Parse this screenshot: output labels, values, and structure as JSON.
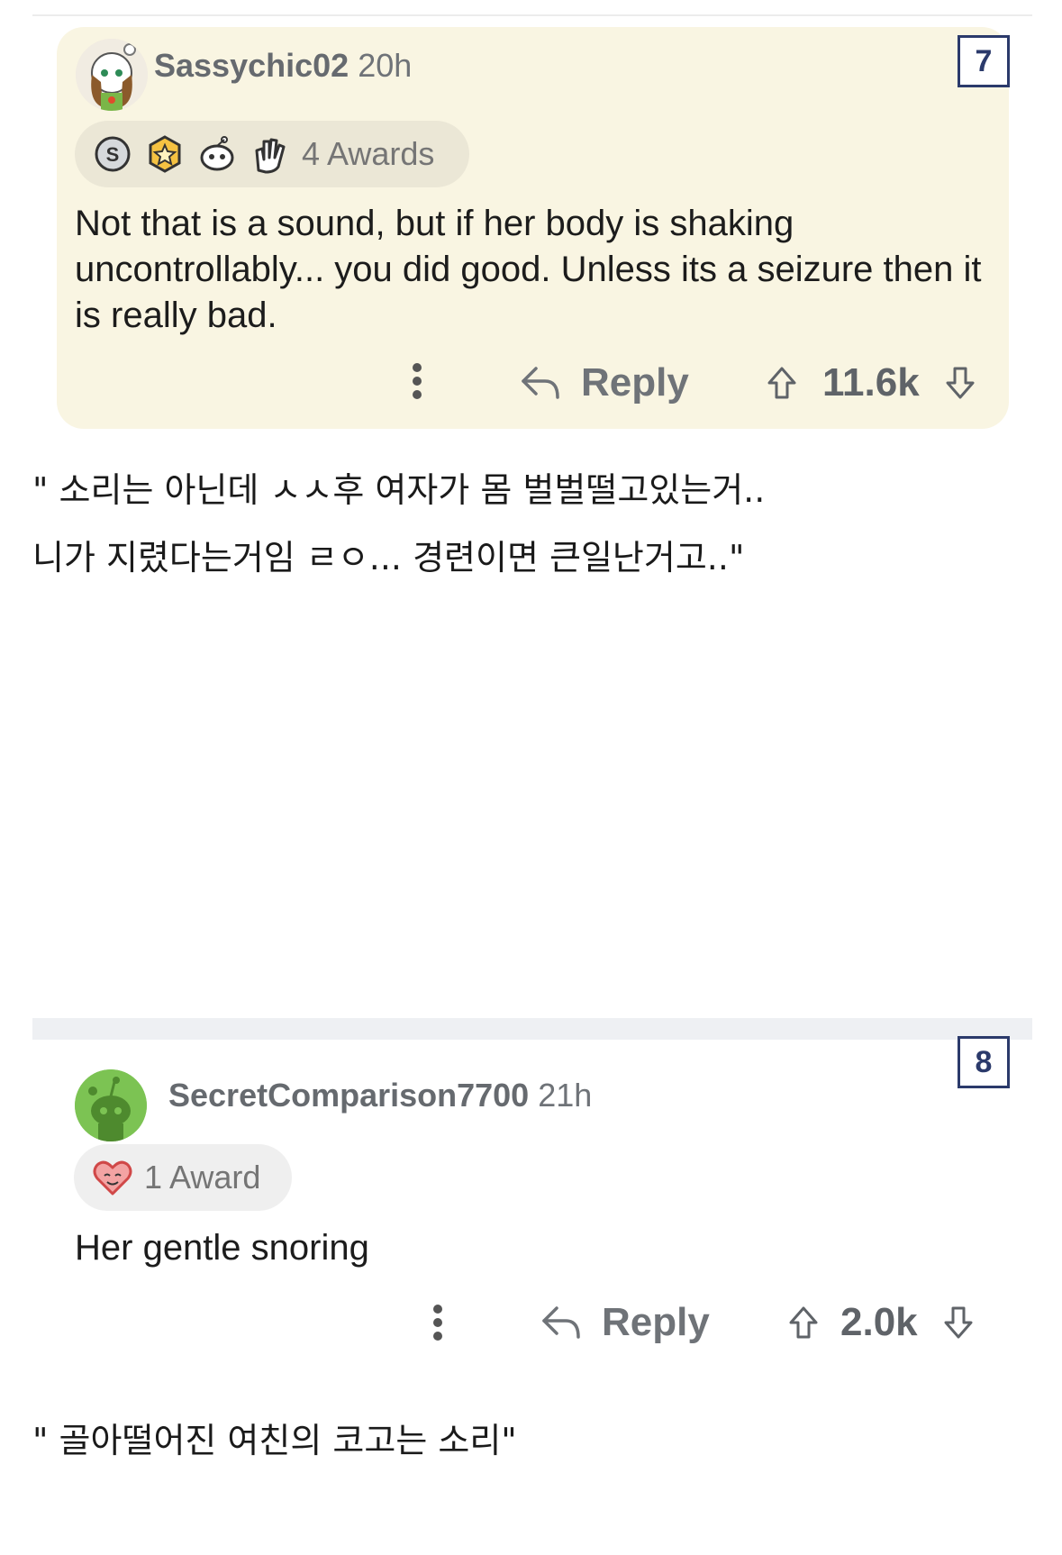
{
  "comments": [
    {
      "number": "7",
      "username": "Sassychic02",
      "time": "20h",
      "awards_label": "4 Awards",
      "award_icons": [
        "silver-coin-icon",
        "gold-award-icon",
        "helpful-snoo-icon",
        "clapping-hands-icon"
      ],
      "text": "Not that is a sound, but if her body is shaking uncontrollably... you did good. Unless its a seizure then it is really bad.",
      "reply_label": "Reply",
      "score": "11.6k"
    },
    {
      "number": "8",
      "username": "SecretComparison7700",
      "time": "21h",
      "awards_label": "1 Award",
      "award_icons": [
        "wholesome-heart-icon"
      ],
      "text": "Her gentle snoring",
      "reply_label": "Reply",
      "score": "2.0k"
    }
  ],
  "translations": {
    "t7_line1": "\" 소리는 아닌데  ㅅㅅ후 여자가 몸 벌벌떨고있는거..",
    "t7_line2": "니가 지렸다는거임 ㄹㅇ... 경련이면 큰일난거고..\"",
    "t8_line1": "\" 골아떨어진 여친의 코고는 소리\""
  },
  "colors": {
    "card_bg": "#f9f5e2",
    "badge_border": "#2b3a6b",
    "muted_text": "#6f7378"
  }
}
